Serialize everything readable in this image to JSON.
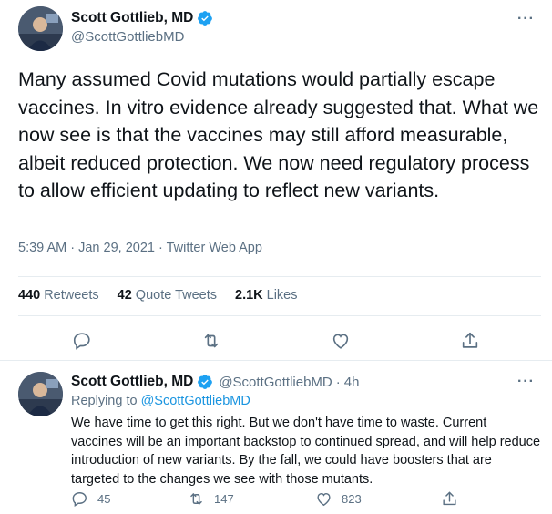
{
  "main_tweet": {
    "author_name": "Scott Gottlieb, MD",
    "author_handle": "@ScottGottliebMD",
    "more_label": "···",
    "text": "Many assumed Covid mutations would partially escape vaccines. In vitro evidence already suggested that. What we now see is that the vaccines may still afford measurable, albeit reduced protection. We now need regulatory process to allow efficient updating to reflect new variants.",
    "time": "5:39 AM",
    "date": "Jan 29, 2021",
    "source": "Twitter Web App",
    "separator": "·",
    "stats": {
      "retweets_count": "440",
      "retweets_label": "Retweets",
      "quotes_count": "42",
      "quotes_label": "Quote Tweets",
      "likes_count": "2.1K",
      "likes_label": "Likes"
    },
    "actions": [
      "reply-icon",
      "retweet-icon",
      "like-icon",
      "share-icon"
    ]
  },
  "reply_tweet": {
    "author_name": "Scott Gottlieb, MD",
    "author_handle": "@ScottGottliebMD",
    "separator": "·",
    "age": "4h",
    "more_label": "···",
    "replying_prefix": "Replying to",
    "replying_to": "@ScottGottliebMD",
    "text": "We have time to get this right. But we don't have time to waste. Current vaccines will be an important backstop to continued spread, and will help reduce introduction of new variants. By the fall, we could have boosters that are targeted to the changes we see with those mutants.",
    "reply_count": "45",
    "retweet_count": "147",
    "like_count": "823"
  },
  "colors": {
    "text": "#0f1419",
    "secondary": "#5b7083",
    "link": "#1b95e0",
    "verified": "#1da1f2",
    "divider": "#e6ecf0"
  }
}
